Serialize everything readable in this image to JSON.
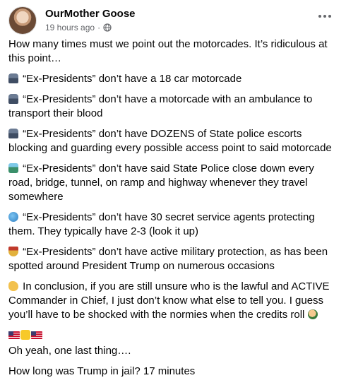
{
  "header": {
    "author": "OurMother Goose",
    "timestamp": "19 hours ago",
    "separator": "·",
    "privacy_icon": "globe-icon",
    "menu_icon": "more-options-icon"
  },
  "post": {
    "intro": "How many times must we point out the motorcades. It’s ridiculous at this point…",
    "items": [
      {
        "icon": "police-car-icon",
        "text": "“Ex-Presidents” don’t have a 18 car motorcade"
      },
      {
        "icon": "police-car-icon",
        "text": "“Ex-Presidents” don’t have a motorcade with an ambulance to transport their blood"
      },
      {
        "icon": "police-car-icon",
        "text": "“Ex-Presidents” don’t have DOZENS of State police escorts blocking and guarding every possible access point to said motorcade"
      },
      {
        "icon": "railway-icon",
        "text": "“Ex-Presidents” don’t have said State Police close down every road, bridge, tunnel, on ramp and highway whenever they travel somewhere"
      },
      {
        "icon": "globe-emoji-icon",
        "text": "“Ex-Presidents” don’t have 30 secret service agents protecting them. They typically have 2-3 (look it up)"
      },
      {
        "icon": "military-medal-icon",
        "text": "“Ex-Presidents” don’t have active military protection, as has been spotted around President Trump on numerous occasions"
      },
      {
        "icon": "pointing-hand-icon",
        "text": "In conclusion, if you are still unsure who is the lawful and ACTIVE Commander in Chief, I just don’t know what else to tell you. I guess you’ll have to be shocked with the normies when the credits roll"
      }
    ],
    "flags_line_icons": [
      "us-flag-icon",
      "yellow-square-icon",
      "us-flag-icon"
    ],
    "closing_1": "Oh yeah, one last thing….",
    "closing_2": "How long was Trump in jail?  17 minutes"
  }
}
